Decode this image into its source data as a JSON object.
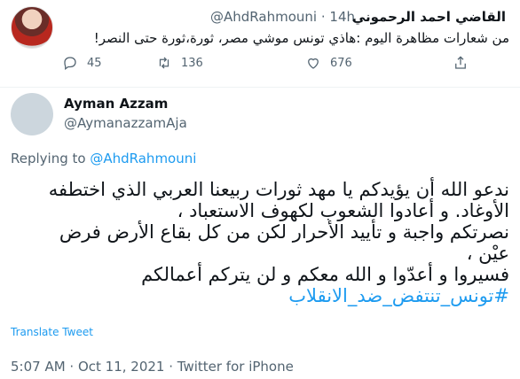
{
  "parent": {
    "name": "القاضي احمد الرحموني",
    "handle": "@AhdRahmouni",
    "separator": "·",
    "time": "14h",
    "text": "من شعارات مظاهرة اليوم :هاذي تونس موشي مصر، ثورة،ثورة حتى النصر!",
    "replies": "45",
    "retweets": "136",
    "likes": "676"
  },
  "reply": {
    "name": "Ayman Azzam",
    "handle": "@AymanazzamAja",
    "replying_prefix": "Replying to",
    "replying_handle": "@AhdRahmouni",
    "lines": [
      "ندعو الله أن يؤيدكم يا مهد ثورات ربيعنا العربي الذي اختطفه",
      "الأوغاد. و أعادوا الشعوب لكهوف الاستعباد ،",
      "نصرتكم واجبة و تأييد الأحرار لكن من كل بقاع الأرض فرض",
      "عيْن ،",
      "فسيروا و أعدّوا و الله معكم و لن يتركم أعمالكم"
    ],
    "hashtag": "#تونس_تنتفض_ضد_الانقلاب",
    "translate_label": "Translate Tweet",
    "timestamp": "5:07 AM · Oct 11, 2021 · Twitter for iPhone"
  },
  "colors": {
    "link": "#1d9bf0",
    "secondary": "#536471",
    "text": "#0f1419"
  }
}
